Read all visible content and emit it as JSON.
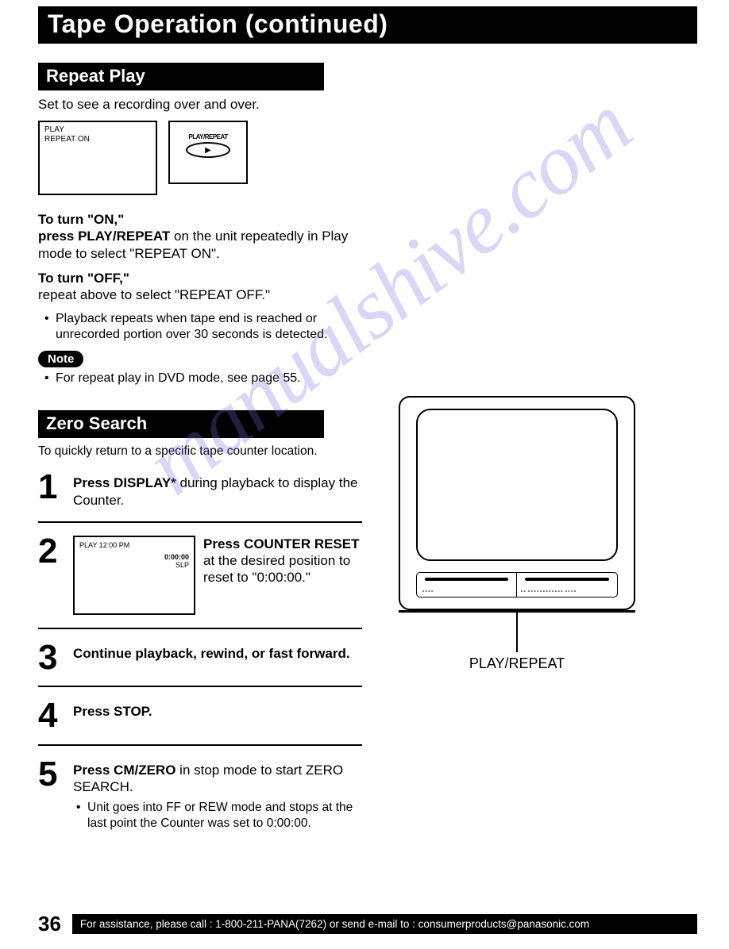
{
  "page_title": "Tape Operation (continued)",
  "watermark": "manualshive.com",
  "repeat_play": {
    "heading": "Repeat Play",
    "intro": "Set to see a recording over and over.",
    "screen1_line1": "PLAY",
    "screen1_line2": "REPEAT ON",
    "screen2_label": "PLAY/REPEAT",
    "screen2_symbol": "▶",
    "on_bold1": "To turn \"ON,\"",
    "on_bold2": "press PLAY/REPEAT",
    "on_rest": " on the unit repeatedly in Play mode to select \"REPEAT ON\".",
    "off_bold": "To turn \"OFF,\"",
    "off_rest": "repeat above to select \"REPEAT OFF.\"",
    "bullet1": "Playback repeats when tape end is reached or unrecorded portion over 30 seconds is detected.",
    "note_label": "Note",
    "note_bullet": "For repeat play in DVD mode, see page 55."
  },
  "zero_search": {
    "heading": "Zero Search",
    "intro": "To quickly return to a specific tape counter location.",
    "step1_bold": "Press DISPLAY*",
    "step1_rest": " during playback to display the Counter.",
    "screen3_line1": "PLAY  12:00 PM",
    "screen3_counter": "0:00:00",
    "screen3_slp": "SLP",
    "step2_bold1": "Press COUNTER RESET",
    "step2_rest": " at the desired position to reset to \"0:00:00.\"",
    "step3": "Continue playback, rewind, or fast forward.",
    "step4": "Press STOP.",
    "step5_bold": "Press CM/ZERO",
    "step5_rest": " in stop mode to start ZERO SEARCH.",
    "step5_bullet": "Unit goes into FF or REW mode and stops at the last point the Counter was set to 0:00:00."
  },
  "tv_label": "PLAY/REPEAT",
  "footer": {
    "page_num": "36",
    "text": "For assistance, please call : 1-800-211-PANA(7262) or send e-mail to : consumerproducts@panasonic.com"
  }
}
